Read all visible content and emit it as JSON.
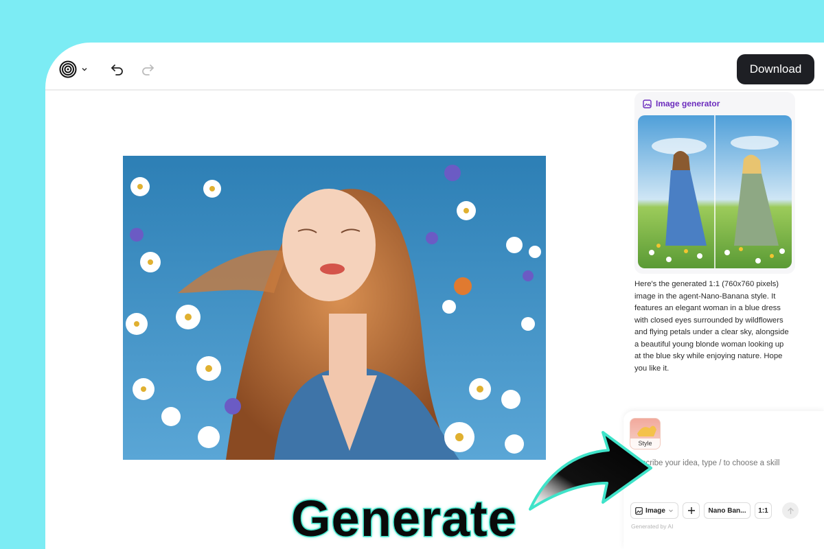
{
  "toolbar": {
    "logo_icon": "spiral-logo-icon",
    "undo_icon": "undo-icon",
    "redo_icon": "redo-icon",
    "download_label": "Download"
  },
  "canvas": {
    "image_desc_icon": "generated-portrait"
  },
  "sidebar": {
    "card_title": "Image generator",
    "reply_text": "Here's the generated 1:1 (760x760 pixels) image in the agent-Nano-Banana style. It features an elegant woman in a blue dress with closed eyes surrounded by wildflowers and flying petals under a clear sky, alongside a beautiful young blonde woman looking up at the blue sky while enjoying nature. Hope you like it."
  },
  "composer": {
    "style_label": "Style",
    "placeholder": "Describe your idea, type / to choose a skill",
    "image_mode_label": "Image",
    "model_label": "Nano Ban...",
    "ratio_label": "1:1",
    "disclaimer": "Generated by AI"
  },
  "overlay": {
    "headline": "Generate"
  },
  "colors": {
    "background": "#7cecf4",
    "accent_purple": "#6b2bbd",
    "dark_button": "#1e1f24",
    "glow": "#3fe3c9"
  }
}
